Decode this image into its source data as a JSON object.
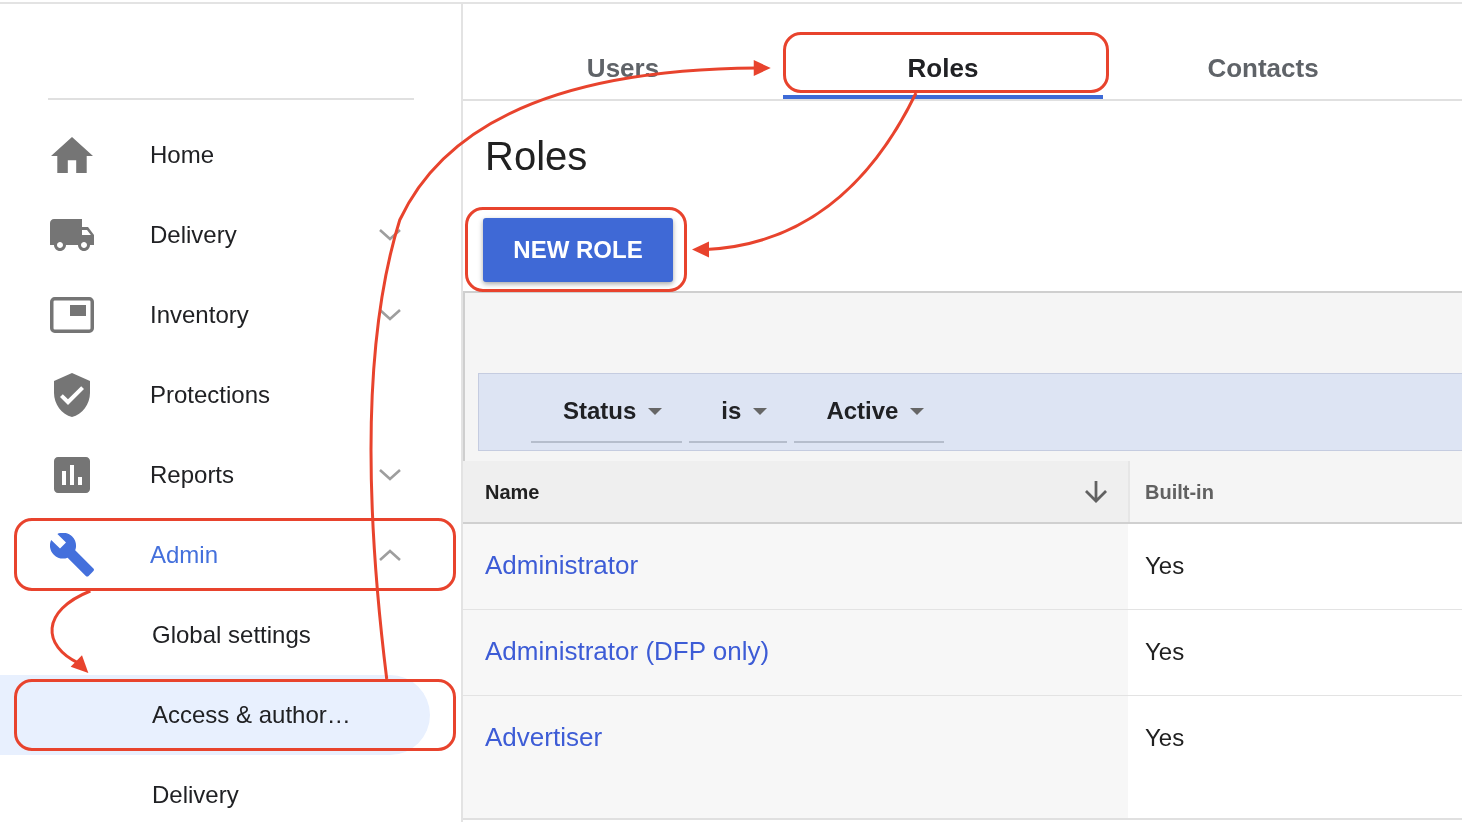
{
  "sidebar": {
    "items": [
      {
        "label": "Home",
        "kind": "link",
        "selected": false,
        "highlighted": false
      },
      {
        "label": "Delivery",
        "kind": "group",
        "expanded": false,
        "selected": false,
        "highlighted": false
      },
      {
        "label": "Inventory",
        "kind": "group",
        "expanded": false,
        "selected": false,
        "highlighted": false
      },
      {
        "label": "Protections",
        "kind": "link",
        "selected": false,
        "highlighted": false
      },
      {
        "label": "Reports",
        "kind": "group",
        "expanded": false,
        "selected": false,
        "highlighted": false
      },
      {
        "label": "Admin",
        "kind": "group",
        "expanded": true,
        "selected": true,
        "highlighted": true,
        "children": [
          {
            "label": "Global settings",
            "selected": false,
            "highlighted": false
          },
          {
            "label": "Access & author…",
            "selected": true,
            "highlighted": true
          },
          {
            "label": "Delivery",
            "selected": false,
            "highlighted": false
          }
        ]
      }
    ]
  },
  "tabs": [
    {
      "label": "Users",
      "selected": false,
      "highlighted": false
    },
    {
      "label": "Roles",
      "selected": true,
      "highlighted": true
    },
    {
      "label": "Contacts",
      "selected": false,
      "highlighted": false
    }
  ],
  "page_title": "Roles",
  "primary_button": {
    "label": "NEW ROLE",
    "highlighted": true
  },
  "filter_chips": [
    "Status",
    "is",
    "Active"
  ],
  "table": {
    "columns": [
      {
        "label": "Name",
        "kind": "link",
        "sorted": true
      },
      {
        "label": "Built-in",
        "kind": "text",
        "sorted": false
      }
    ],
    "rows": [
      [
        "Administrator",
        "Yes"
      ],
      [
        "Administrator (DFP only)",
        "Yes"
      ],
      [
        "Advertiser",
        "Yes"
      ]
    ]
  }
}
